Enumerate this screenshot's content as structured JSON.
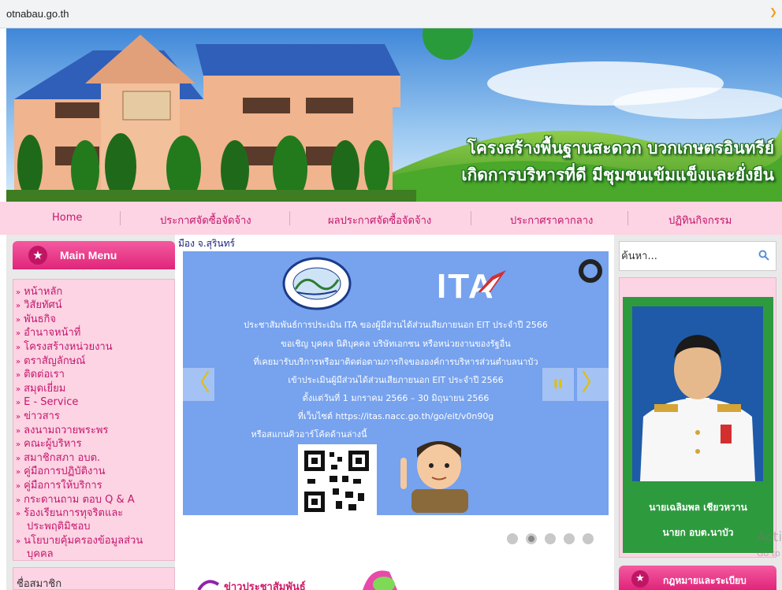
{
  "browser": {
    "url": "otnabau.go.th"
  },
  "banner": {
    "slogan_line1": "โครงสร้างพื้นฐานสะดวก บวกเกษตรอินทรีย์",
    "slogan_line2": "เกิดการบริหารที่ดี มีชุมชนเข้มแข็งและยั่งยืน"
  },
  "nav": [
    "Home",
    "ประกาศจัดซื้อจัดจ้าง",
    "ผลประกาศจัดซื้อจัดจ้าง",
    "ประกาศราคากลาง",
    "ปฏิทินกิจกรรม"
  ],
  "main_menu": {
    "title": "Main Menu",
    "items": [
      "หน้าหลัก",
      "วิสัยทัศน์",
      "พันธกิจ",
      "อำนาจหน้าที่",
      "โครงสร้างหน่วยงาน",
      "ตราสัญลักษณ์",
      "ติดต่อเรา",
      "สมุดเยี่ยม",
      "E - Service",
      "ข่าวสาร",
      "ลงนามถวายพระพร",
      "คณะผู้บริหาร",
      "สมาชิกสภา อบต.",
      "คู่มือการปฏิบัติงาน",
      "คู่มือการให้บริการ",
      "กระดานถาม ตอบ Q & A"
    ],
    "item_complaint": [
      "ร้องเรียนการทุจริตและ",
      "ประพฤติมิชอบ"
    ],
    "item_privacy": [
      "นโยบายคุ้มครองข้อมูลส่วน",
      "บุคคล"
    ]
  },
  "member_label": "ชื่อสมาชิก",
  "breadcrumb": "มือง จ.สุรินทร์",
  "slider": {
    "logo_text": "ITA",
    "lines": [
      "ประชาสัมพันธ์การประเมิน ITA ของผู้มีส่วนได้ส่วนเสียภายนอก EIT ประจำปี 2566",
      "ขอเชิญ บุคคล นิติบุคคล บริษัทเอกชน หรือหน่วยงานของรัฐอื่น",
      "ที่เคยมารับบริการหรือมาติดต่อตามภารกิจขององค์การบริหารส่วนตำบลนาบัว",
      "เข้าประเมินผู้มีส่วนได้ส่วนเสียภายนอก EIT ประจำปี 2566",
      "ตั้งแต่วันที่ 1 มกราคม 2566 – 30 มิถุนายน 2566",
      "ที่เว็บไซต์ https://itas.nacc.go.th/go/eit/v0n90g",
      "หรือสแกนคิวอาร์โค้ดด้านล่างนี้"
    ],
    "prev": "〈",
    "pause": "II",
    "next": "〉",
    "dot_count": 5,
    "active_dot": 2
  },
  "news_banner": "ข่าวประชาสัมพันธ์",
  "search": {
    "placeholder": "ค้นหา..."
  },
  "executive": {
    "name": "นายเฉลิมพล เชียวหวาน",
    "position": "นายก อบต.นาบัว"
  },
  "law_header": "กฎหมายและระเบียบ",
  "watermark": {
    "line1": "Acti",
    "line2": "Go to"
  },
  "colors": {
    "pink_bar": "#fcd4e4",
    "menu_text": "#c5176b",
    "slider_bg": "#76a2ee",
    "exec_green": "#2e9a3e"
  }
}
